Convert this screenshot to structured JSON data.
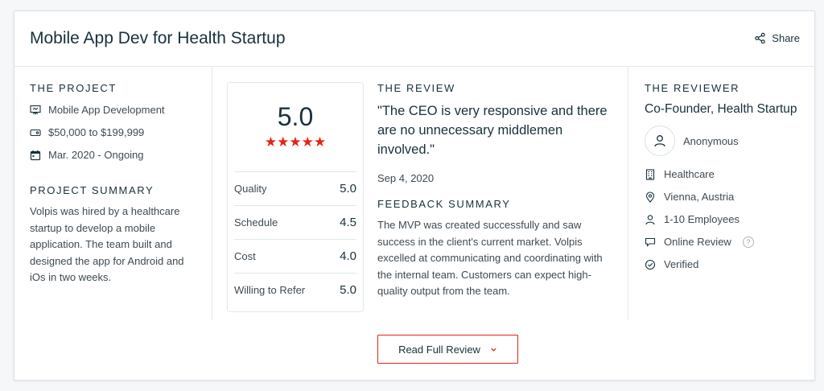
{
  "title": "Mobile App Dev for Health Startup",
  "share_label": "Share",
  "project": {
    "heading": "THE PROJECT",
    "items": [
      {
        "icon": "presentation-icon",
        "text": "Mobile App Development"
      },
      {
        "icon": "price-tag-icon",
        "text": "$50,000 to $199,999"
      },
      {
        "icon": "calendar-icon",
        "text": "Mar. 2020 - Ongoing"
      }
    ],
    "summary_heading": "PROJECT SUMMARY",
    "summary_text": "Volpis was hired by a healthcare startup to develop a mobile application. The team built and designed the app for Android and iOs in two weeks."
  },
  "rating": {
    "overall": "5.0",
    "stars": 5,
    "star_color": "#e62415",
    "rows": [
      {
        "label": "Quality",
        "value": "5.0"
      },
      {
        "label": "Schedule",
        "value": "4.5"
      },
      {
        "label": "Cost",
        "value": "4.0"
      },
      {
        "label": "Willing to Refer",
        "value": "5.0"
      }
    ]
  },
  "review": {
    "heading": "THE REVIEW",
    "quote": "\"The CEO is very responsive and there are no unnecessary middlemen involved.\"",
    "date": "Sep 4, 2020",
    "feedback_heading": "FEEDBACK SUMMARY",
    "feedback_text": "The MVP was created successfully and saw success in the client's current market. Volpis excelled at communicating and coordinating with the internal team. Customers can expect high-quality output from the team."
  },
  "reviewer": {
    "heading": "THE REVIEWER",
    "role": "Co-Founder, Health Startup",
    "name": "Anonymous",
    "items": [
      {
        "icon": "building-icon",
        "text": "Healthcare"
      },
      {
        "icon": "location-pin-icon",
        "text": "Vienna, Austria"
      },
      {
        "icon": "user-icon",
        "text": "1-10 Employees"
      },
      {
        "icon": "chat-bubble-icon",
        "text": "Online Review"
      },
      {
        "icon": "check-circle-icon",
        "text": "Verified"
      }
    ]
  },
  "button": {
    "label": "Read Full Review"
  },
  "accent_color": "#e62415"
}
